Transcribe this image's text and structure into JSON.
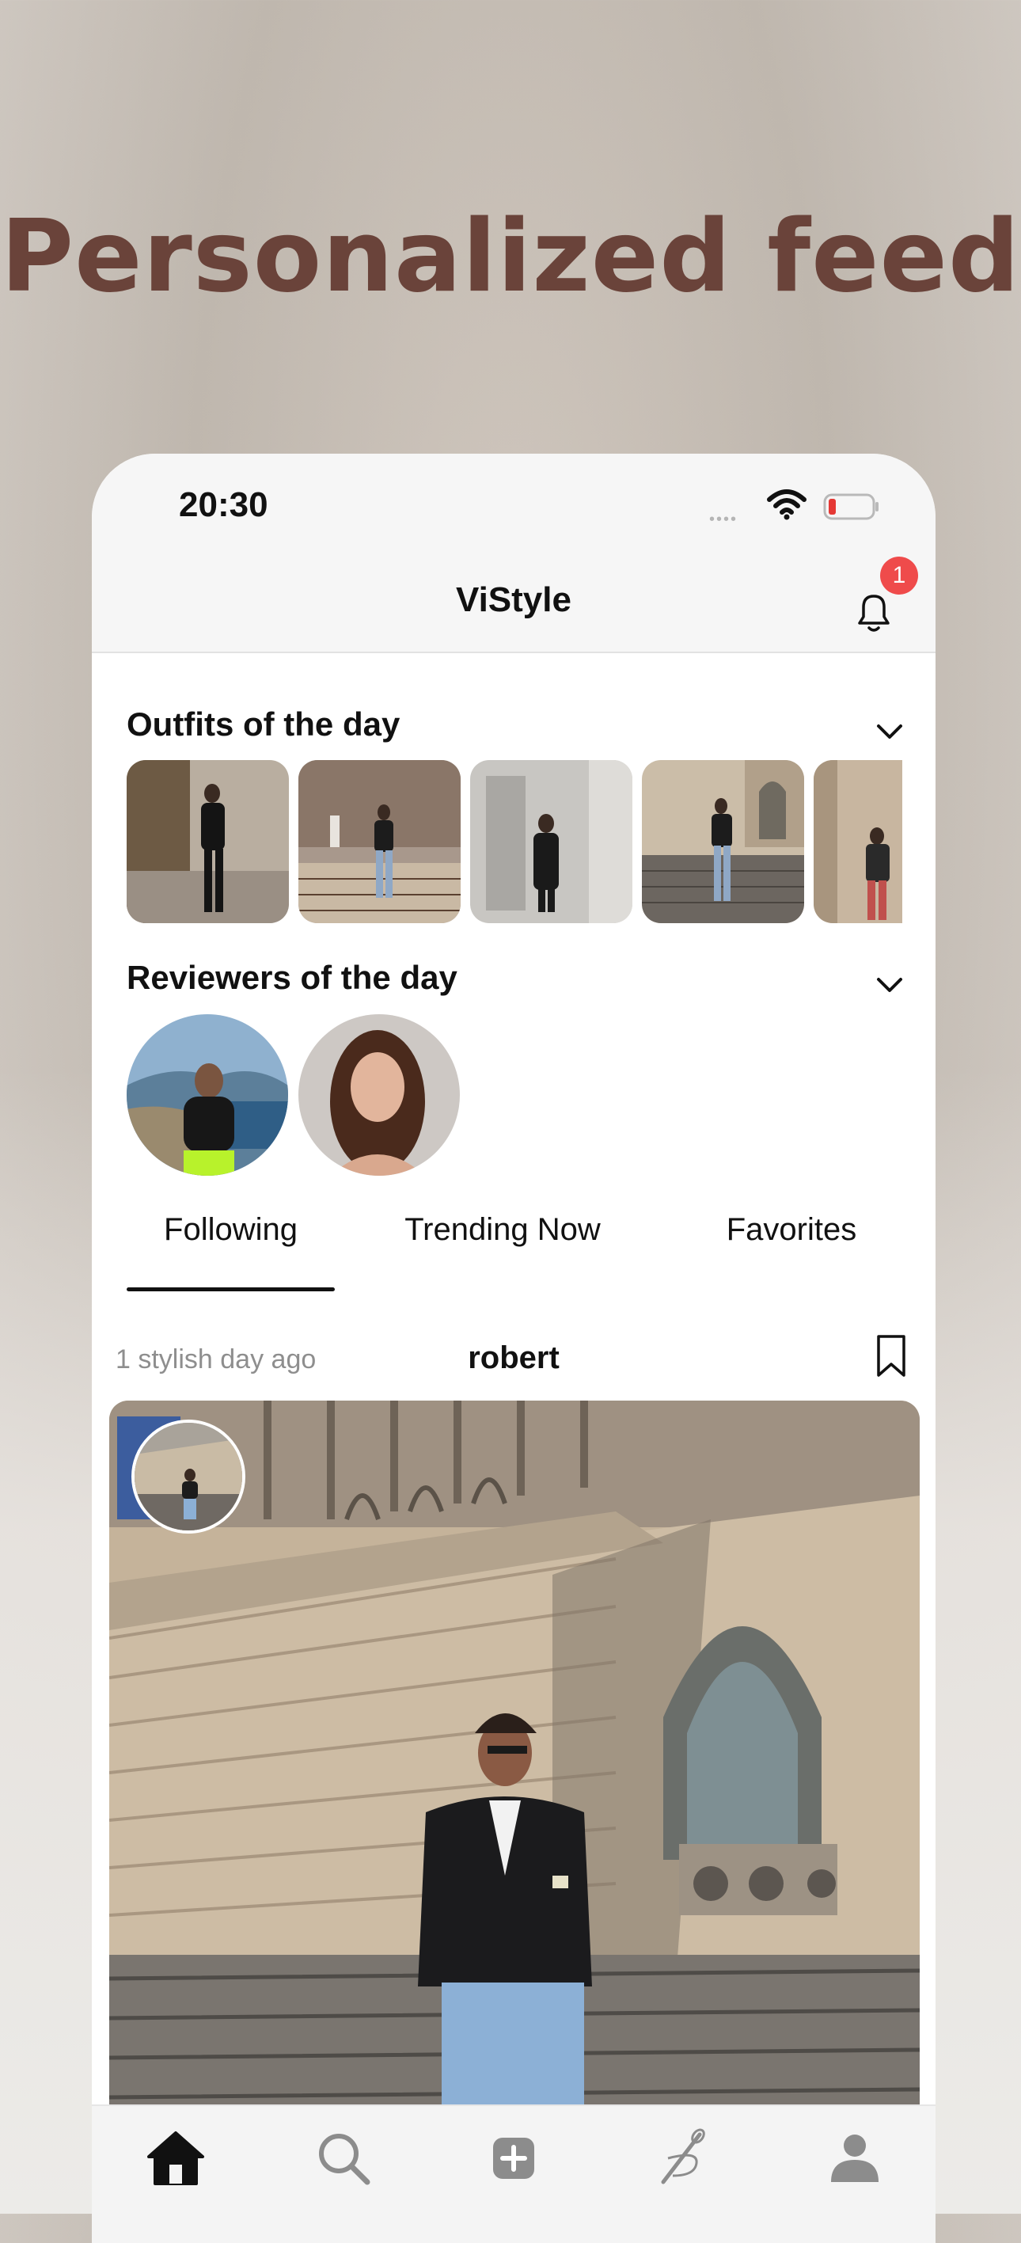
{
  "headline": "Personalized feed",
  "status_bar": {
    "time": "20:30",
    "signal_dots": "••••"
  },
  "navbar": {
    "title": "ViStyle",
    "notification_count": "1"
  },
  "sections": {
    "outfits_title": "Outfits of the day",
    "reviewers_title": "Reviewers of the day"
  },
  "tabs": [
    {
      "label": "Following",
      "active": true
    },
    {
      "label": "Trending Now",
      "active": false
    },
    {
      "label": "Favorites",
      "active": false
    }
  ],
  "post": {
    "time_text": "1 stylish day ago",
    "username": "robert"
  },
  "bottom_tabs": [
    "home-icon",
    "search-icon",
    "add-icon",
    "sewing-needle-icon",
    "profile-icon"
  ],
  "colors": {
    "headline": "#6a433a",
    "badge": "#ef4b4b",
    "active_tab": "#111111"
  }
}
